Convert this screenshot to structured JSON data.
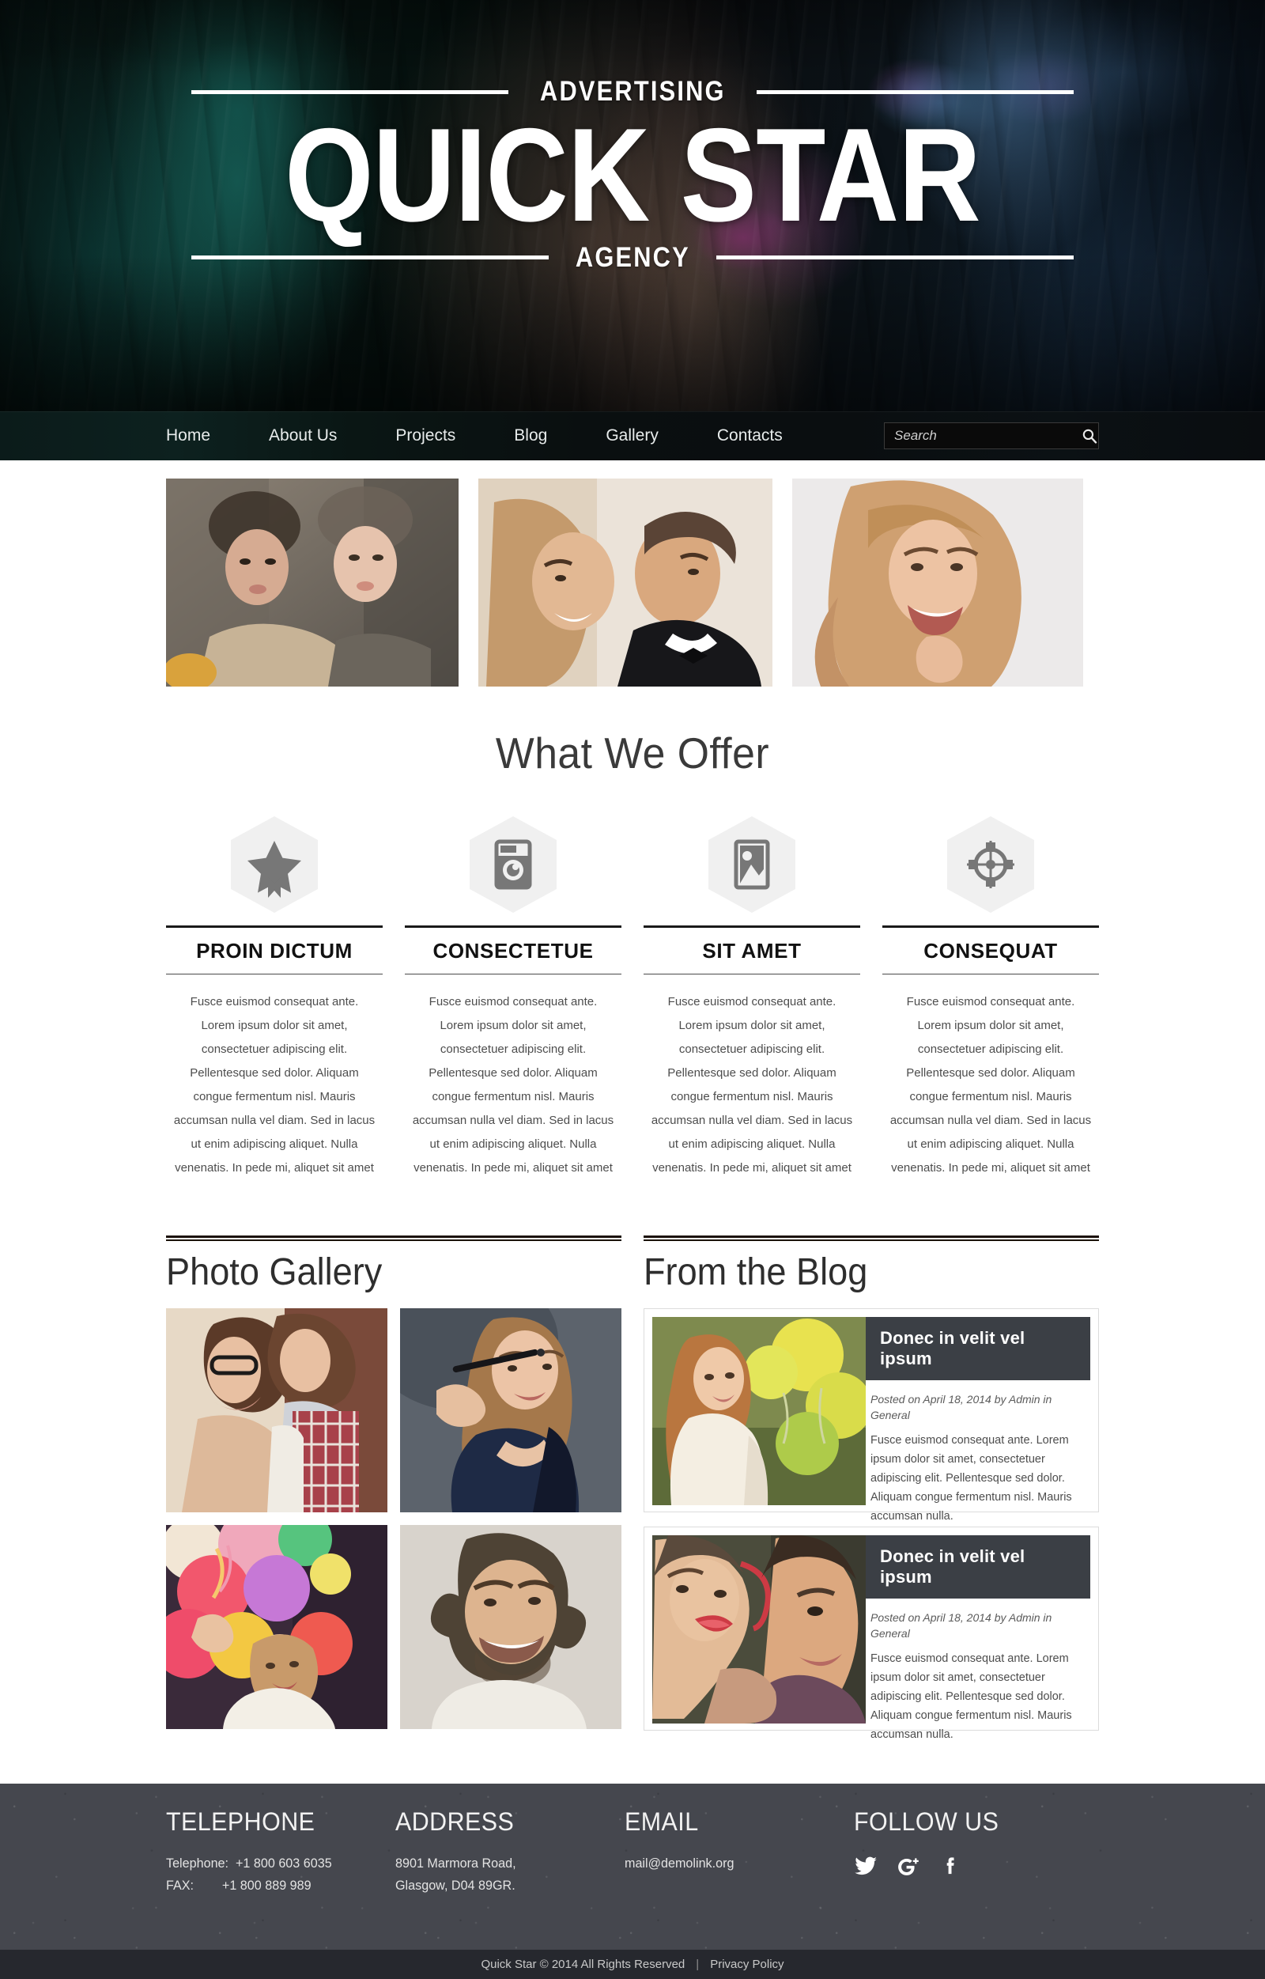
{
  "header": {
    "kicker_top": "ADVERTISING",
    "brand": "QUICK STAR",
    "kicker_bottom": "AGENCY"
  },
  "nav": {
    "items": [
      {
        "label": "Home"
      },
      {
        "label": "About Us"
      },
      {
        "label": "Projects"
      },
      {
        "label": "Blog"
      },
      {
        "label": "Gallery"
      },
      {
        "label": "Contacts"
      }
    ],
    "search": {
      "placeholder": "Search",
      "value": "",
      "icon": "search-icon"
    }
  },
  "slider": {
    "slides": [
      {
        "alt": "Two women in knit scarves portrait"
      },
      {
        "alt": "Couple in evening wear foreheads touching"
      },
      {
        "alt": "Smiling woman with long wavy blonde hair"
      }
    ]
  },
  "offer": {
    "title": "What We Offer",
    "body_text": "Fusce euismod consequat ante. Lorem ipsum dolor sit amet, consectetuer adipiscing elit. Pellentesque sed dolor. Aliquam congue fermentum nisl. Mauris accumsan nulla vel diam. Sed in lacus ut enim adipiscing aliquet. Nulla venenatis. In pede mi, aliquet sit amet",
    "items": [
      {
        "icon": "star-icon",
        "title": "PROIN DICTUM"
      },
      {
        "icon": "camera-icon",
        "title": "CONSECTETUE"
      },
      {
        "icon": "image-icon",
        "title": "SIT AMET"
      },
      {
        "icon": "target-icon",
        "title": "CONSEQUAT"
      }
    ]
  },
  "gallery": {
    "title": "Photo Gallery",
    "items": [
      {
        "alt": "Couple with glasses about to kiss"
      },
      {
        "alt": "Woman in blue blazer holding pen"
      },
      {
        "alt": "Woman holding colourful balloons"
      },
      {
        "alt": "Smiling bearded man portrait"
      }
    ]
  },
  "blog": {
    "title": "From the Blog",
    "posts": [
      {
        "title": "Donec in velit vel ipsum",
        "meta": "Posted on April 18, 2014 by Admin in General",
        "text": "Fusce euismod consequat ante. Lorem ipsum dolor sit amet, consectetuer adipiscing elit. Pellentesque sed dolor. Aliquam congue fermentum nisl. Mauris accumsan nulla.",
        "thumb_alt": "Woman with yellow and green balloons"
      },
      {
        "title": "Donec in velit vel ipsum",
        "meta": "Posted on April 18, 2014 by Admin in General",
        "text": "Fusce euismod consequat ante. Lorem ipsum dolor sit amet, consectetuer adipiscing elit. Pellentesque sed dolor. Aliquam congue fermentum nisl. Mauris accumsan nulla.",
        "thumb_alt": "Couple with red lipstick close up"
      }
    ]
  },
  "footer": {
    "telephone": {
      "heading": "TELEPHONE",
      "line1": "Telephone:  +1 800 603 6035",
      "line2": "FAX:        +1 800 889 989"
    },
    "address": {
      "heading": "ADDRESS",
      "line1": "8901 Marmora Road,",
      "line2": "Glasgow, D04 89GR."
    },
    "email": {
      "heading": "EMAIL",
      "line1": "mail@demolink.org"
    },
    "follow": {
      "heading": "FOLLOW US",
      "socials": [
        {
          "name": "twitter-icon"
        },
        {
          "name": "google-plus-icon"
        },
        {
          "name": "facebook-icon"
        }
      ]
    }
  },
  "copyright": {
    "text": "Quick Star © 2014 All Rights Reserved",
    "separator": "|",
    "link": "Privacy Policy"
  },
  "colors": {
    "footer_bg": "#45474e",
    "copy_bg": "#26282e",
    "post_title_bg": "#3b3f45",
    "hex_fill": "#f0f0f0",
    "icon_fill": "#777777"
  }
}
